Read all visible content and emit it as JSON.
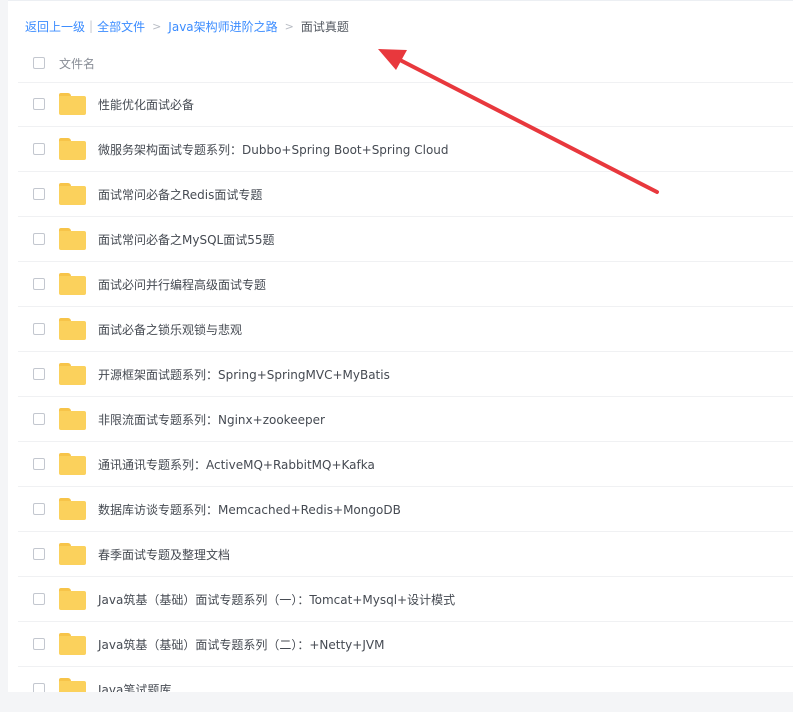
{
  "breadcrumb": {
    "back": "返回上一级",
    "all_files": "全部文件",
    "level1": "Java架构师进阶之路",
    "current": "面试真题"
  },
  "header": {
    "name_column": "文件名"
  },
  "files": [
    {
      "name": "性能优化面试必备",
      "icon": "folder-icon"
    },
    {
      "name": "微服务架构面试专题系列：Dubbo+Spring Boot+Spring Cloud",
      "icon": "folder-icon"
    },
    {
      "name": "面试常问必备之Redis面试专题",
      "icon": "folder-icon"
    },
    {
      "name": "面试常问必备之MySQL面试55题",
      "icon": "folder-icon"
    },
    {
      "name": "面试必问并行编程高级面试专题",
      "icon": "folder-icon"
    },
    {
      "name": "面试必备之锁乐观锁与悲观",
      "icon": "folder-icon"
    },
    {
      "name": "开源框架面试题系列：Spring+SpringMVC+MyBatis",
      "icon": "folder-icon"
    },
    {
      "name": "非限流面试专题系列：Nginx+zookeeper",
      "icon": "folder-icon"
    },
    {
      "name": "通讯通讯专题系列：ActiveMQ+RabbitMQ+Kafka",
      "icon": "folder-icon"
    },
    {
      "name": "数据库访谈专题系列：Memcached+Redis+MongoDB",
      "icon": "folder-icon"
    },
    {
      "name": "春季面试专题及整理文档",
      "icon": "folder-icon"
    },
    {
      "name": "Java筑基（基础）面试专题系列（一）：Tomcat+Mysql+设计模式",
      "icon": "folder-icon"
    },
    {
      "name": "Java筑基（基础）面试专题系列（二）：+Netty+JVM",
      "icon": "folder-icon"
    },
    {
      "name": "Java笔试题库",
      "icon": "folder-icon"
    }
  ],
  "colors": {
    "link": "#3b8cff",
    "folder": "#fbd15c",
    "annotation_arrow": "#e8383d"
  }
}
